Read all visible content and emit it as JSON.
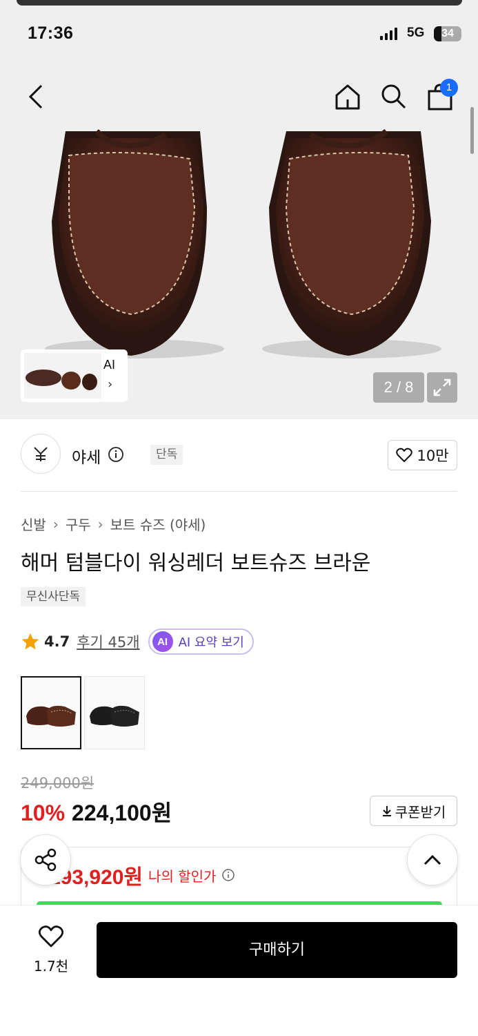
{
  "status_bar": {
    "time": "17:36",
    "network": "5G",
    "battery": "34"
  },
  "header": {
    "cart_count": "1"
  },
  "gallery": {
    "counter": "2 / 8",
    "ai_label": "AI"
  },
  "brand": {
    "name": "야세",
    "badge": "단독",
    "likes": "10만"
  },
  "breadcrumb": [
    "신발",
    "구두",
    "보트 슈즈 (야세)"
  ],
  "product": {
    "title": "해머 텀블다이 워싱레더 보트슈즈 브라운",
    "exclusive_badge": "무신사단독",
    "rating": "4.7",
    "reviews": "후기 45개",
    "ai_summary": "AI 요약 보기",
    "ai_icon": "AI"
  },
  "color_options": [
    "brown",
    "black"
  ],
  "price": {
    "original": "249,000원",
    "discount": "10%",
    "final": "224,100원",
    "coupon": "쿠폰받기"
  },
  "benefit": {
    "price": "193,920원",
    "label": "나의 할인가"
  },
  "bottom": {
    "wish_count": "1.7천",
    "buy_label": "구매하기"
  },
  "colors": {
    "sale_red": "#e0201f",
    "badge_blue": "#1a6cff",
    "progress_green": "#2ee05a"
  }
}
